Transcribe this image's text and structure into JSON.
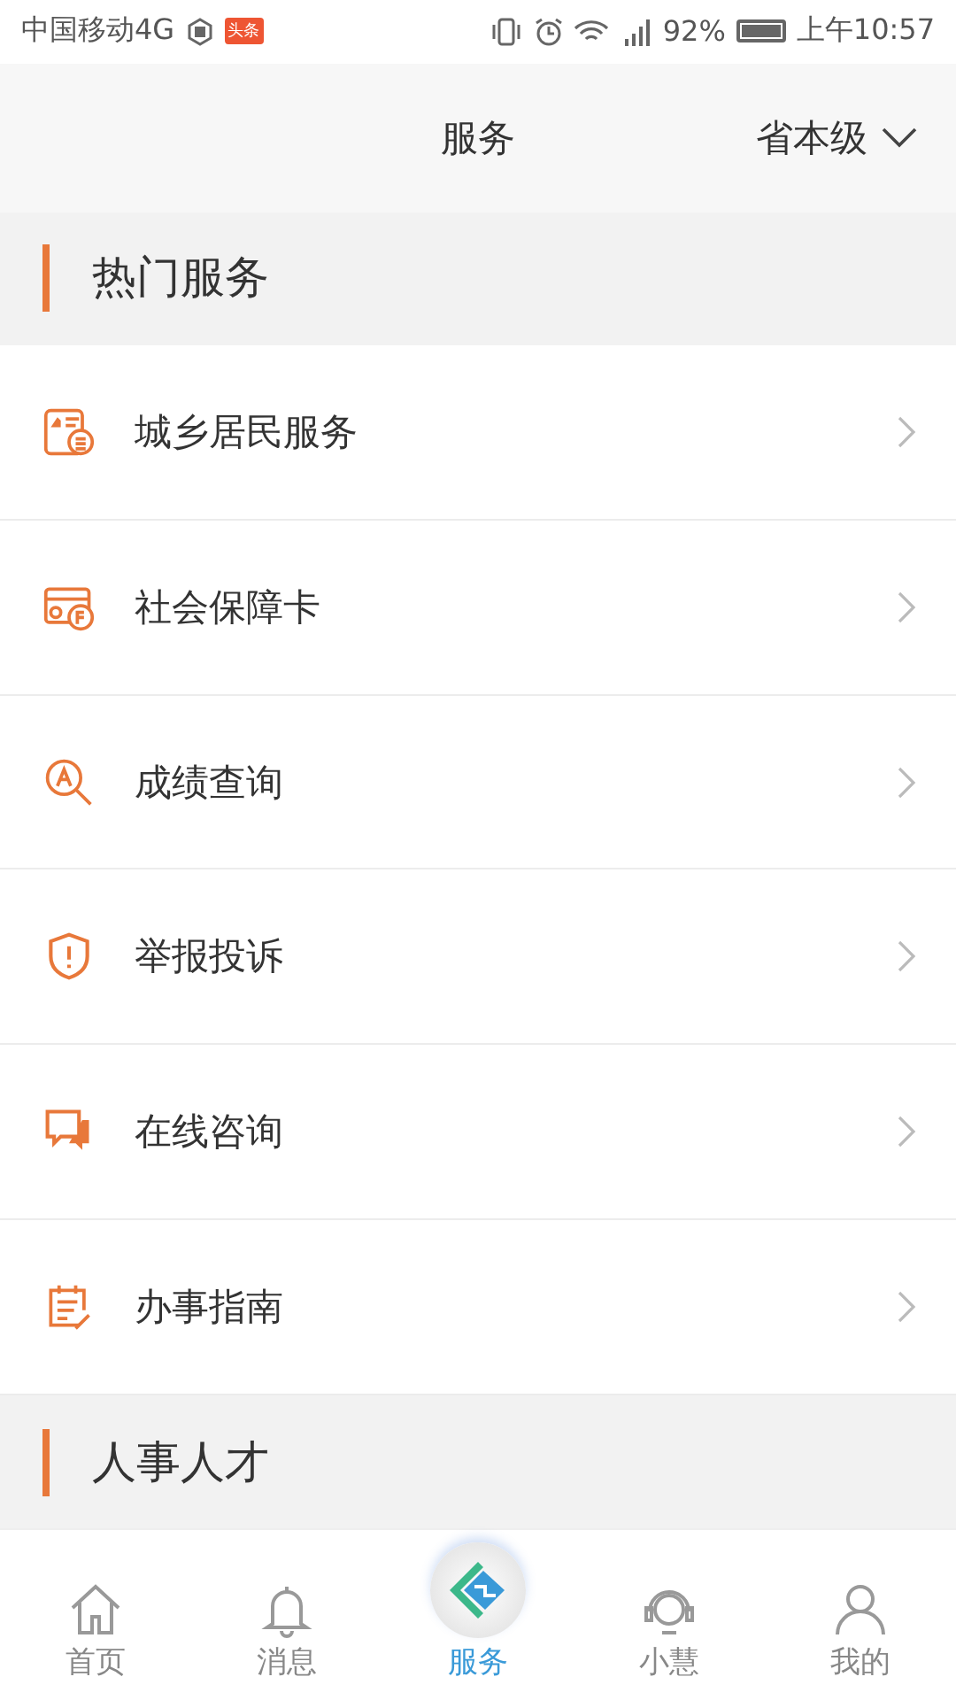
{
  "status_bar": {
    "carrier": "中国移动4G",
    "app_badge": "头条",
    "battery": "92%",
    "time": "上午10:57"
  },
  "header": {
    "title": "服务",
    "region": "省本级"
  },
  "sections": [
    {
      "title": "热门服务",
      "items": [
        {
          "kind": "resident",
          "label": "城乡居民服务"
        },
        {
          "kind": "card",
          "label": "社会保障卡"
        },
        {
          "kind": "search",
          "label": "成绩查询"
        },
        {
          "kind": "shield",
          "label": "举报投诉"
        },
        {
          "kind": "chat",
          "label": "在线咨询"
        },
        {
          "kind": "guide",
          "label": "办事指南"
        }
      ]
    },
    {
      "title": "人事人才"
    }
  ],
  "tab_bar": [
    {
      "kind": "home",
      "label": "首页",
      "selected": false
    },
    {
      "kind": "bell",
      "label": "消息",
      "selected": false
    },
    {
      "kind": "logo",
      "label": "服务",
      "selected": true
    },
    {
      "kind": "headset",
      "label": "小慧",
      "selected": false
    },
    {
      "kind": "person",
      "label": "我的",
      "selected": false
    }
  ]
}
